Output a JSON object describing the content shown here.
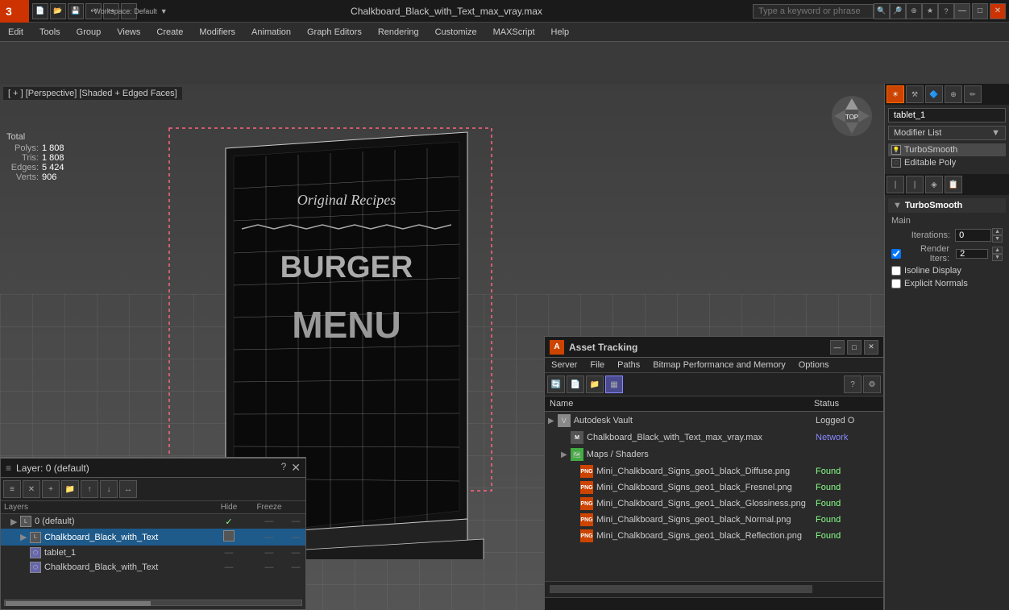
{
  "titlebar": {
    "workspace": "Workspace: Default",
    "filename": "Chalkboard_Black_with_Text_max_vray.max",
    "search_placeholder": "Type a keyword or phrase",
    "min": "—",
    "max": "□",
    "close": "✕"
  },
  "menubar": {
    "items": [
      "Edit",
      "Tools",
      "Group",
      "Views",
      "Create",
      "Modifiers",
      "Animation",
      "Graph Editors",
      "Rendering",
      "Customize",
      "MAXScript",
      "Help"
    ]
  },
  "viewport": {
    "label": "[ + ] [Perspective] [Shaded + Edged Faces]",
    "stats": {
      "polys_label": "Polys:",
      "polys_value": "1 808",
      "tris_label": "Tris:",
      "tris_value": "1 808",
      "edges_label": "Edges:",
      "edges_value": "5 424",
      "verts_label": "Verts:",
      "verts_value": "906",
      "total": "Total"
    }
  },
  "rightpanel": {
    "icons": [
      "☀",
      "⚙",
      "🔷",
      "🌐",
      "✏"
    ],
    "object_name": "tablet_1",
    "modifier_list_label": "Modifier List",
    "modifiers": [
      {
        "name": "TurboSmooth",
        "active": true
      },
      {
        "name": "Editable Poly",
        "active": false
      }
    ],
    "subpanel_icons": [
      "↑",
      "↓",
      "↔",
      "📋"
    ],
    "turbosmooth": {
      "header": "TurboSmooth",
      "main_label": "Main",
      "iterations_label": "Iterations:",
      "iterations_value": "0",
      "render_iters_label": "Render Iters:",
      "render_iters_value": "2",
      "isoline_display": "Isoline Display",
      "explicit_normals": "Explicit Normals"
    }
  },
  "layerpanel": {
    "title": "Layer: 0 (default)",
    "toolbar_icons": [
      "≡",
      "✕",
      "+",
      "📁",
      "📤",
      "📥",
      "🔁"
    ],
    "columns": {
      "name": "Layers",
      "hide": "Hide",
      "freeze": "Freeze"
    },
    "layers": [
      {
        "indent": 0,
        "name": "0 (default)",
        "check": "✓",
        "dashes": "— — —"
      },
      {
        "indent": 1,
        "name": "Chalkboard_Black_with_Text",
        "selected": true,
        "dashes": "— — —"
      },
      {
        "indent": 2,
        "name": "tablet_1",
        "dashes": "— — —"
      },
      {
        "indent": 2,
        "name": "Chalkboard_Black_with_Text",
        "dashes": "— — —"
      }
    ]
  },
  "assetpanel": {
    "title": "Asset Tracking",
    "menus": [
      "Server",
      "File",
      "Paths",
      "Bitmap Performance and Memory",
      "Options"
    ],
    "toolbar_icons_left": [
      "🔄",
      "📄",
      "📁",
      "📋"
    ],
    "toolbar_icons_right": [
      "?",
      "⚙"
    ],
    "columns": {
      "name": "Name",
      "status": "Status"
    },
    "tree": [
      {
        "type": "group",
        "icon": "vault",
        "name": "Autodesk Vault",
        "status": "Logged O",
        "children": [
          {
            "type": "file",
            "icon": "max",
            "name": "Chalkboard_Black_with_Text_max_vray.max",
            "status": "Network",
            "status_class": "network"
          }
        ]
      },
      {
        "type": "subgroup",
        "icon": "maps",
        "name": "Maps / Shaders",
        "children": [
          {
            "type": "file",
            "icon": "png",
            "name": "Mini_Chalkboard_Signs_geo1_black_Diffuse.png",
            "status": "Found"
          },
          {
            "type": "file",
            "icon": "png",
            "name": "Mini_Chalkboard_Signs_geo1_black_Fresnel.png",
            "status": "Found"
          },
          {
            "type": "file",
            "icon": "png",
            "name": "Mini_Chalkboard_Signs_geo1_black_Glossiness.png",
            "status": "Found"
          },
          {
            "type": "file",
            "icon": "png",
            "name": "Mini_Chalkboard_Signs_geo1_black_Normal.png",
            "status": "Found"
          },
          {
            "type": "file",
            "icon": "png",
            "name": "Mini_Chalkboard_Signs_geo1_black_Reflection.png",
            "status": "Found"
          }
        ]
      }
    ]
  }
}
